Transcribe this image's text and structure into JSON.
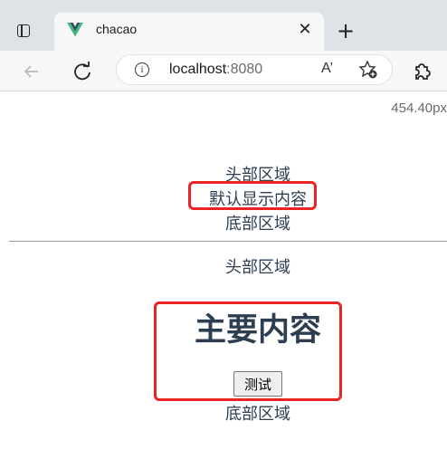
{
  "browser": {
    "tab": {
      "title": "chacao",
      "favicon": "vue-logo-icon",
      "close_glyph": "✕"
    },
    "new_tab_glyph": "+",
    "address_bar": {
      "host": "localhost",
      "port": ":8080"
    },
    "read_aloud_label": "A’",
    "icons": [
      "tab-actions-icon",
      "back-arrow-icon",
      "reload-icon",
      "info-icon",
      "read-aloud-icon",
      "add-favorite-icon",
      "extensions-icon"
    ]
  },
  "page": {
    "width_readout": "454.40px",
    "section1": {
      "header": "头部区域",
      "content": "默认显示内容",
      "footer": "底部区域"
    },
    "section2": {
      "header": "头部区域",
      "heading": "主要内容",
      "button_label": "测试",
      "footer": "底部区域"
    }
  },
  "colors": {
    "text": "#2c3e50",
    "highlight": "#e82424",
    "vue_green": "#41b883",
    "vue_dark": "#35495e"
  }
}
